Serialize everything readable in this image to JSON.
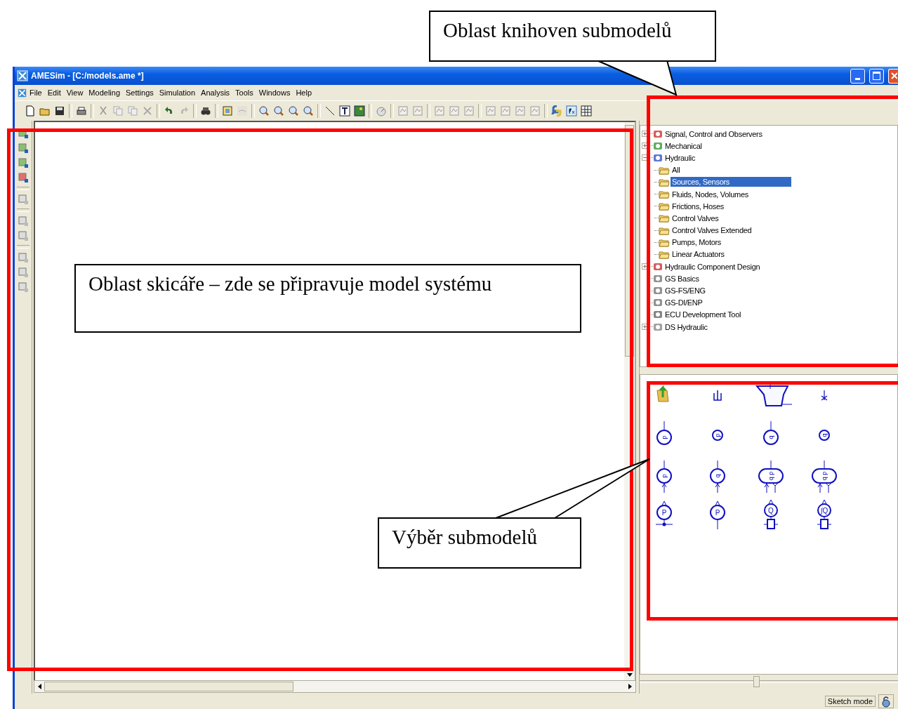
{
  "callouts": [
    {
      "text": "Oblast knihoven submodelů"
    },
    {
      "text": "Oblast skicáře – zde se připravuje model systému"
    },
    {
      "text": "Výběr submodelů"
    }
  ],
  "window": {
    "title": "AMESim - [C:/models.ame *]"
  },
  "menu": [
    {
      "label": "File"
    },
    {
      "label": "Edit"
    },
    {
      "label": "View"
    },
    {
      "label": "Modeling"
    },
    {
      "label": "Settings"
    },
    {
      "label": "Simulation"
    },
    {
      "label": "Analysis"
    },
    {
      "label": "Tools"
    },
    {
      "label": "Windows"
    },
    {
      "label": "Help"
    }
  ],
  "library_tree": [
    {
      "label": "Signal, Control and Observers",
      "expanded": false,
      "selected": false
    },
    {
      "label": "Mechanical",
      "expanded": false,
      "selected": false
    },
    {
      "label": "Hydraulic",
      "expanded": true,
      "selected": false,
      "children": [
        {
          "label": "All",
          "selected": false
        },
        {
          "label": "Sources, Sensors",
          "selected": true
        },
        {
          "label": "Fluids, Nodes, Volumes",
          "selected": false
        },
        {
          "label": "Frictions, Hoses",
          "selected": false
        },
        {
          "label": "Control Valves",
          "selected": false
        },
        {
          "label": "Control Valves Extended",
          "selected": false
        },
        {
          "label": "Pumps, Motors",
          "selected": false
        },
        {
          "label": "Linear Actuators",
          "selected": false
        }
      ]
    },
    {
      "label": "Hydraulic Component Design",
      "expanded": false,
      "selected": false
    },
    {
      "label": "GS Basics",
      "selected": false
    },
    {
      "label": "GS-FS/ENG",
      "selected": false
    },
    {
      "label": "GS-DI/ENP",
      "selected": false
    },
    {
      "label": "ECU Development Tool",
      "selected": false
    },
    {
      "label": "DS Hydraulic",
      "expanded": false,
      "selected": false
    }
  ],
  "palette": [
    {
      "kind": "folder-up"
    },
    {
      "kind": "tank"
    },
    {
      "kind": "reservoir"
    },
    {
      "kind": "plug"
    },
    {
      "kind": "stem-sensor",
      "label": "p"
    },
    {
      "kind": "small-sensor",
      "label": "p"
    },
    {
      "kind": "stem-sensor",
      "label": "q"
    },
    {
      "kind": "small-sensor",
      "label": "q"
    },
    {
      "kind": "inline-sensor",
      "label": "p"
    },
    {
      "kind": "inline-sensor",
      "label": "q"
    },
    {
      "kind": "dual-sensor",
      "label": "q p"
    },
    {
      "kind": "dual-sensor",
      "label": "q p"
    },
    {
      "kind": "junction-transducer",
      "label": "P"
    },
    {
      "kind": "line-transducer",
      "label": "P"
    },
    {
      "kind": "flow-transducer",
      "label": "Q"
    },
    {
      "kind": "flow-transducer",
      "label": "∫Q"
    }
  ],
  "zoom_slider": {
    "level": 0.45
  },
  "status_bar": {
    "mode": "Sketch mode"
  }
}
